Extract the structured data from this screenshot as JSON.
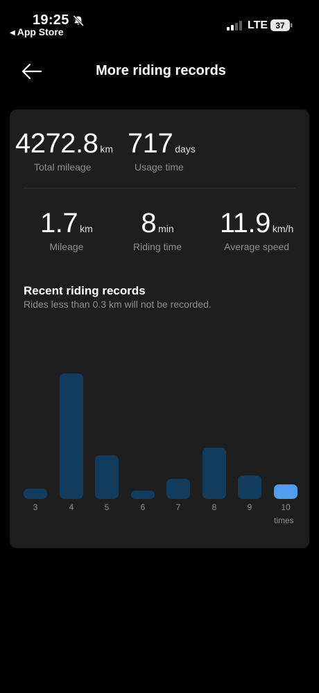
{
  "status_bar": {
    "time": "19:25",
    "back_label": "App Store",
    "network": "LTE",
    "battery": "37"
  },
  "header": {
    "title": "More riding records",
    "back_icon": "arrow-left-icon"
  },
  "summary": {
    "total_mileage": {
      "value": "4272.8",
      "unit": "km",
      "label": "Total mileage"
    },
    "usage_time": {
      "value": "717",
      "unit": "days",
      "label": "Usage time"
    }
  },
  "last_ride": {
    "mileage": {
      "value": "1.7",
      "unit": "km",
      "label": "Mileage"
    },
    "riding_time": {
      "value": "8",
      "unit": "min",
      "label": "Riding time"
    },
    "average_speed": {
      "value": "11.9",
      "unit": "km/h",
      "label": "Average speed"
    }
  },
  "recent": {
    "title": "Recent riding records",
    "subtitle": "Rides less than 0.3 km will not be recorded."
  },
  "chart_data": {
    "type": "bar",
    "categories": [
      "3",
      "4",
      "5",
      "6",
      "7",
      "8",
      "9",
      "10"
    ],
    "values": [
      1.5,
      18,
      6.3,
      1.1,
      2.9,
      7.4,
      3.4,
      2.1
    ],
    "x_unit": "times",
    "highlighted_category": "10",
    "colors": {
      "bar": "#123c5e",
      "highlight": "#4f9cf0"
    }
  }
}
